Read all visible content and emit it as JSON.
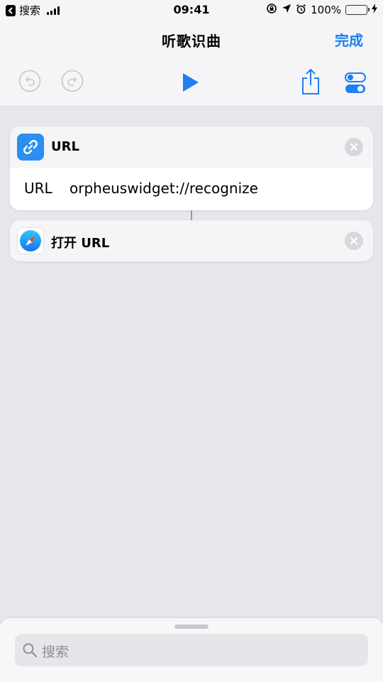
{
  "status": {
    "back_app": "搜索",
    "time": "09:41",
    "battery": "100%",
    "battery_level": 1.0
  },
  "nav": {
    "title": "听歌识曲",
    "done": "完成"
  },
  "actions": [
    {
      "title": "URL",
      "icon": "link-icon",
      "param_label": "URL",
      "param_value": "orpheuswidget://recognize"
    },
    {
      "title": "打开 URL",
      "icon": "safari-compass-icon"
    }
  ],
  "search": {
    "placeholder": "搜索"
  },
  "colors": {
    "accent": "#1e7ff0",
    "battery": "#4cd964",
    "background": "#e6e7ea"
  }
}
